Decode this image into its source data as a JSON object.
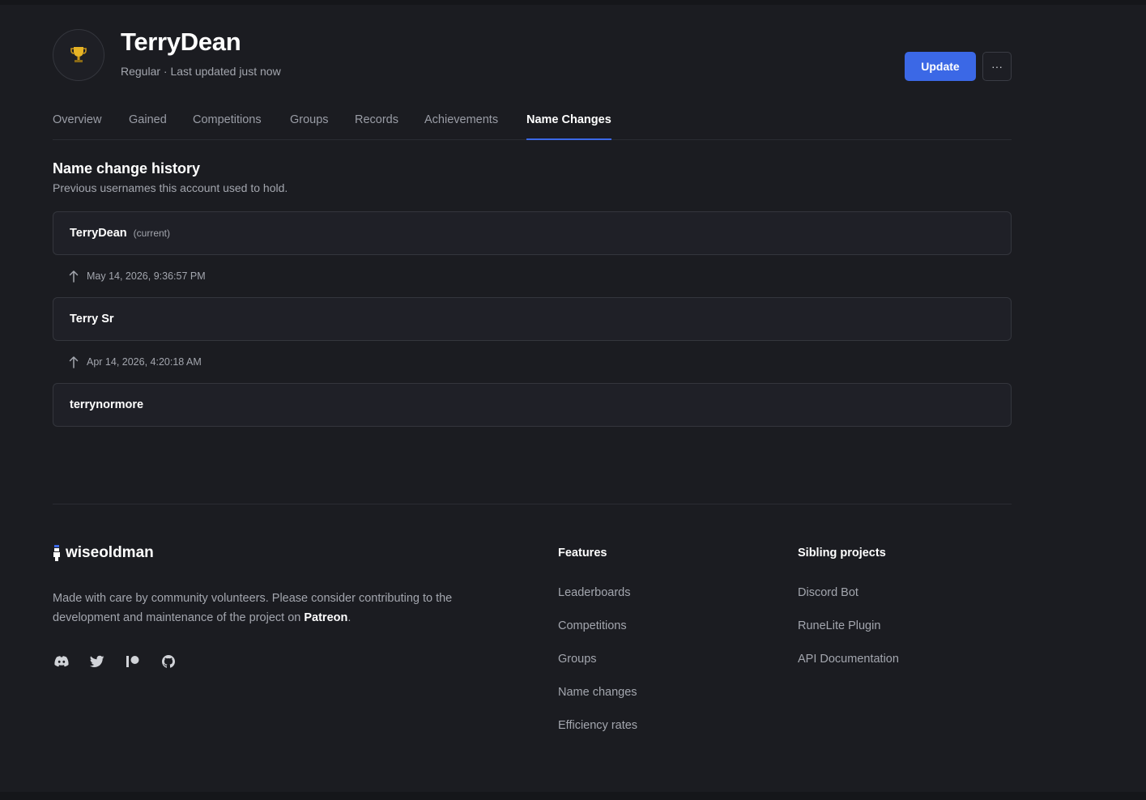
{
  "player": {
    "name": "TerryDean",
    "subtitle": "Regular · Last updated just now",
    "icon": "trophy-icon"
  },
  "actions": {
    "update_label": "Update",
    "more_label": "···"
  },
  "tabs": [
    {
      "label": "Overview"
    },
    {
      "label": "Gained"
    },
    {
      "label": "Competitions"
    },
    {
      "label": "Groups"
    },
    {
      "label": "Records"
    },
    {
      "label": "Achievements"
    },
    {
      "label": "Name Changes",
      "active": true
    }
  ],
  "history": {
    "title": "Name change history",
    "description": "Previous usernames this account used to hold.",
    "current_name": "TerryDean",
    "current_tag": "(current)",
    "changes": [
      {
        "date": "May 14, 2026, 9:36:57 PM",
        "name": "Terry Sr"
      },
      {
        "date": "Apr 14, 2026, 4:20:18 AM",
        "name": "terrynormore"
      }
    ]
  },
  "footer": {
    "logo_text": "wiseoldman",
    "description_prefix": "Made with care by community volunteers. Please consider contributing to the development and maintenance of the project on ",
    "description_link": "Patreon",
    "description_suffix": ".",
    "socials": [
      "discord-icon",
      "twitter-icon",
      "patreon-icon",
      "github-icon"
    ],
    "features": {
      "title": "Features",
      "links": [
        "Leaderboards",
        "Competitions",
        "Groups",
        "Name changes",
        "Efficiency rates"
      ]
    },
    "siblings": {
      "title": "Sibling projects",
      "links": [
        "Discord Bot",
        "RuneLite Plugin",
        "API Documentation"
      ]
    }
  },
  "colors": {
    "background": "#1b1c21",
    "accent": "#3b68e6",
    "card": "#1f2027",
    "muted_text": "#a3a6ae"
  }
}
